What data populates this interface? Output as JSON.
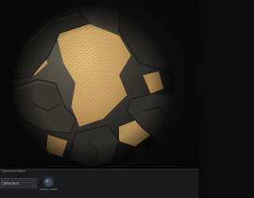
{
  "viewport": {
    "preview_object": "textured sphere",
    "colors": {
      "background": "#0b0b0c",
      "stone_dark": "#2a2823",
      "stone_mid": "#4a463d",
      "sand": "#c9a468"
    }
  },
  "bottom_panel": {
    "title": "Exploration Bone",
    "tab_label": "Collections",
    "items": [
      {
        "label": "explore_marble...",
        "icon": "material-ball-thumbnail"
      }
    ]
  }
}
